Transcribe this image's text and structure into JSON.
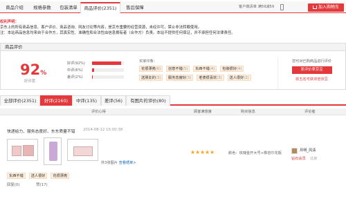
{
  "top_tabs": [
    {
      "label": "商品介绍"
    },
    {
      "label": "规格参数"
    },
    {
      "label": "包装清单"
    },
    {
      "label": "商品评价(2351)"
    },
    {
      "label": "售后保障"
    }
  ],
  "qr": {
    "label": "客户端清单 满59减59"
  },
  "cart_button": {
    "label": "加入购物车"
  },
  "notice": {
    "title": "权利声明：",
    "line1": "京东上的所有商品信息、客户评价、商品咨询、网友讨论等内容，是京东重要的经营资源，未经许可，禁止非法转载使用。",
    "line2": "注：本站商品信息均来自于合作方，其真实性、准确性和合法性由信息拥有者（合作方）负责。本站不提供任何保证，并不承担任何法律责任。"
  },
  "summary": {
    "title": "商品评价",
    "rate": "92",
    "rate_unit": "%",
    "rate_label": "好评度",
    "bars": [
      {
        "label": "好评(92%)",
        "percent": 92
      },
      {
        "label": "中评(6%)",
        "percent": 6
      },
      {
        "label": "差评(2%)",
        "percent": 2
      }
    ],
    "impression_label": "买家印象：",
    "tags": [
      {
        "text": "花很漂亮",
        "count": "(6)"
      },
      {
        "text": "创意不错",
        "count": "(5)"
      },
      {
        "text": "东西不错",
        "count": "(4)"
      },
      {
        "text": "包装很好",
        "count": "(4)"
      },
      {
        "text": "送朋友的",
        "count": "(3)"
      },
      {
        "text": "服务态度好",
        "count": "(3)"
      },
      {
        "text": "老婆很喜欢",
        "count": "(3)"
      },
      {
        "text": "送人很好",
        "count": "(2)"
      }
    ],
    "side_text": "您可对已购商品进行评价",
    "review_button": "发评价拿京豆",
    "side_link": "前五名可获双倍京豆"
  },
  "review_tabs": [
    {
      "label": "全部评价(2351)"
    },
    {
      "label": "好评(2160)"
    },
    {
      "label": "中评(135)"
    },
    {
      "label": "差评(56)"
    },
    {
      "label": "有图片的评价(80)"
    }
  ],
  "columns": {
    "content": "评价心得",
    "satisfaction": "顾客满意度",
    "purchase": "购买信息",
    "reviewer": "评论者"
  },
  "review": {
    "text": "快递给力、服务态度好、东东质量不错",
    "date": "2014-08-12 15:00:38",
    "photo_count": "共3张图片",
    "photo_link": "查看晒单>",
    "stars": 5,
    "color_label": "颜色：",
    "color_value": "玫瑰金开大号+橡容尔花瓶",
    "username": "月明_风清",
    "level": "钻石会员",
    "location": "北京",
    "tags": [
      "东西不错",
      "送人很好",
      "花很漂亮"
    ],
    "reply": "回复(0)",
    "useful": "赞(17)"
  }
}
